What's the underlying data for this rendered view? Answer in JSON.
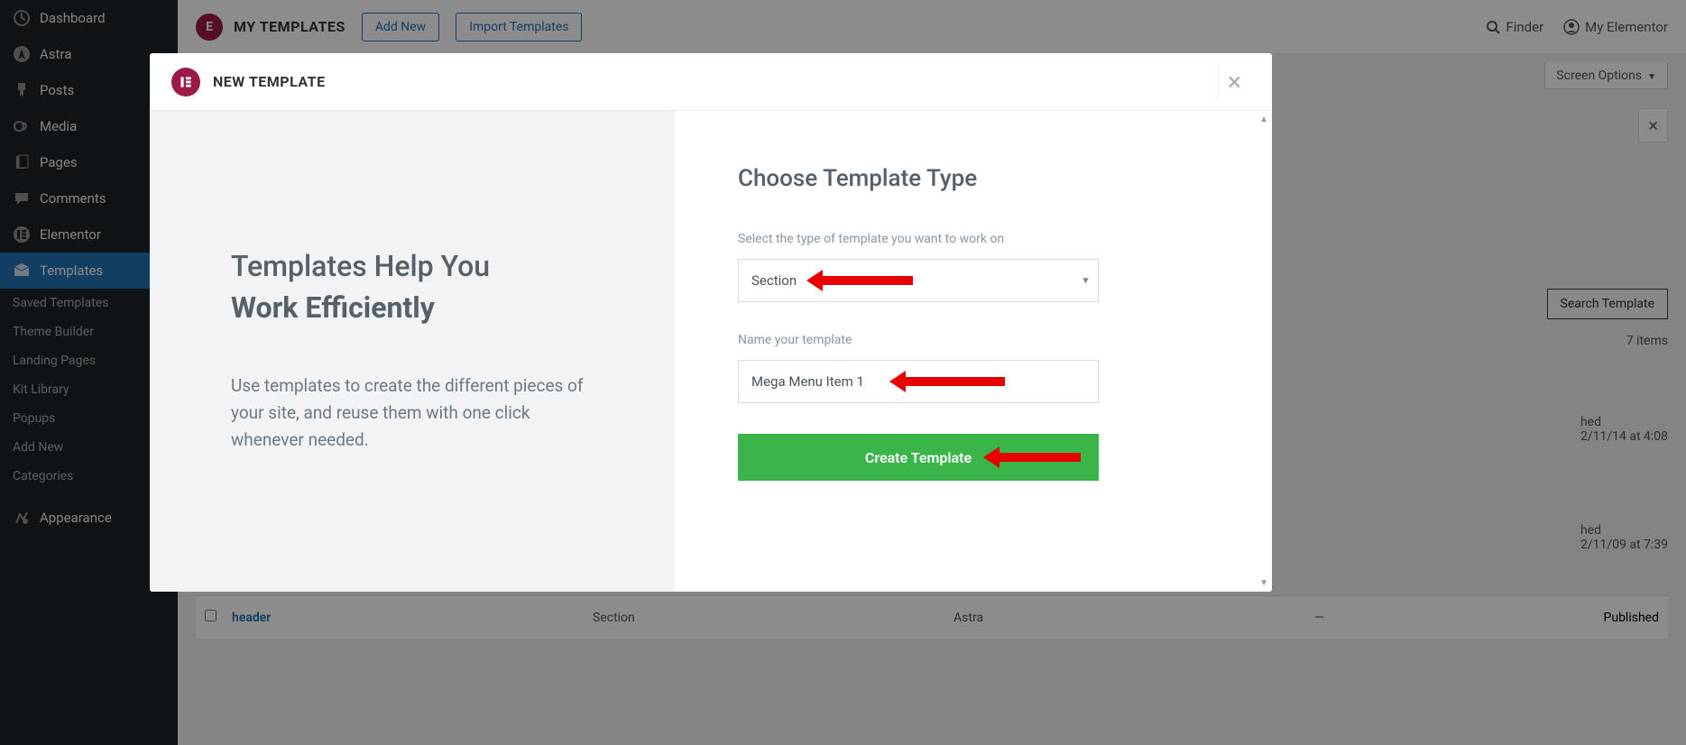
{
  "sidebar": {
    "items": [
      {
        "label": "Dashboard",
        "icon": "dashboard"
      },
      {
        "label": "Astra",
        "icon": "astra"
      },
      {
        "label": "Posts",
        "icon": "pin"
      },
      {
        "label": "Media",
        "icon": "media"
      },
      {
        "label": "Pages",
        "icon": "pages"
      },
      {
        "label": "Comments",
        "icon": "comments"
      },
      {
        "label": "Elementor",
        "icon": "elementor"
      },
      {
        "label": "Templates",
        "icon": "templates",
        "active": true
      },
      {
        "label": "Appearance",
        "icon": "appearance"
      }
    ],
    "subItems": [
      "Saved Templates",
      "Theme Builder",
      "Landing Pages",
      "Kit Library",
      "Popups",
      "Add New",
      "Categories"
    ]
  },
  "topbar": {
    "title": "MY TEMPLATES",
    "addNew": "Add New",
    "import": "Import Templates",
    "finder": "Finder",
    "myElementor": "My Elementor"
  },
  "page": {
    "screenOptions": "Screen Options",
    "searchTemplate": "Search Template",
    "itemsCount": "7 items",
    "row1": {
      "title": "header",
      "type": "Section",
      "author": "Astra",
      "date": "—",
      "status": "Published"
    },
    "dateBlock1": {
      "status": "hed",
      "date": "2/11/14 at 4:08"
    },
    "dateBlock2": {
      "status": "hed",
      "date": "2/11/09 at 7:39"
    }
  },
  "modal": {
    "headerTitle": "NEW TEMPLATE",
    "left": {
      "line1": "Templates Help You",
      "line2": "Work Efficiently",
      "desc": "Use templates to create the different pieces of your site, and reuse them with one click whenever needed."
    },
    "right": {
      "heading": "Choose Template Type",
      "selectLabel": "Select the type of template you want to work on",
      "selectValue": "Section",
      "nameLabel": "Name your template",
      "nameValue": "Mega Menu Item 1",
      "button": "Create Template"
    }
  }
}
